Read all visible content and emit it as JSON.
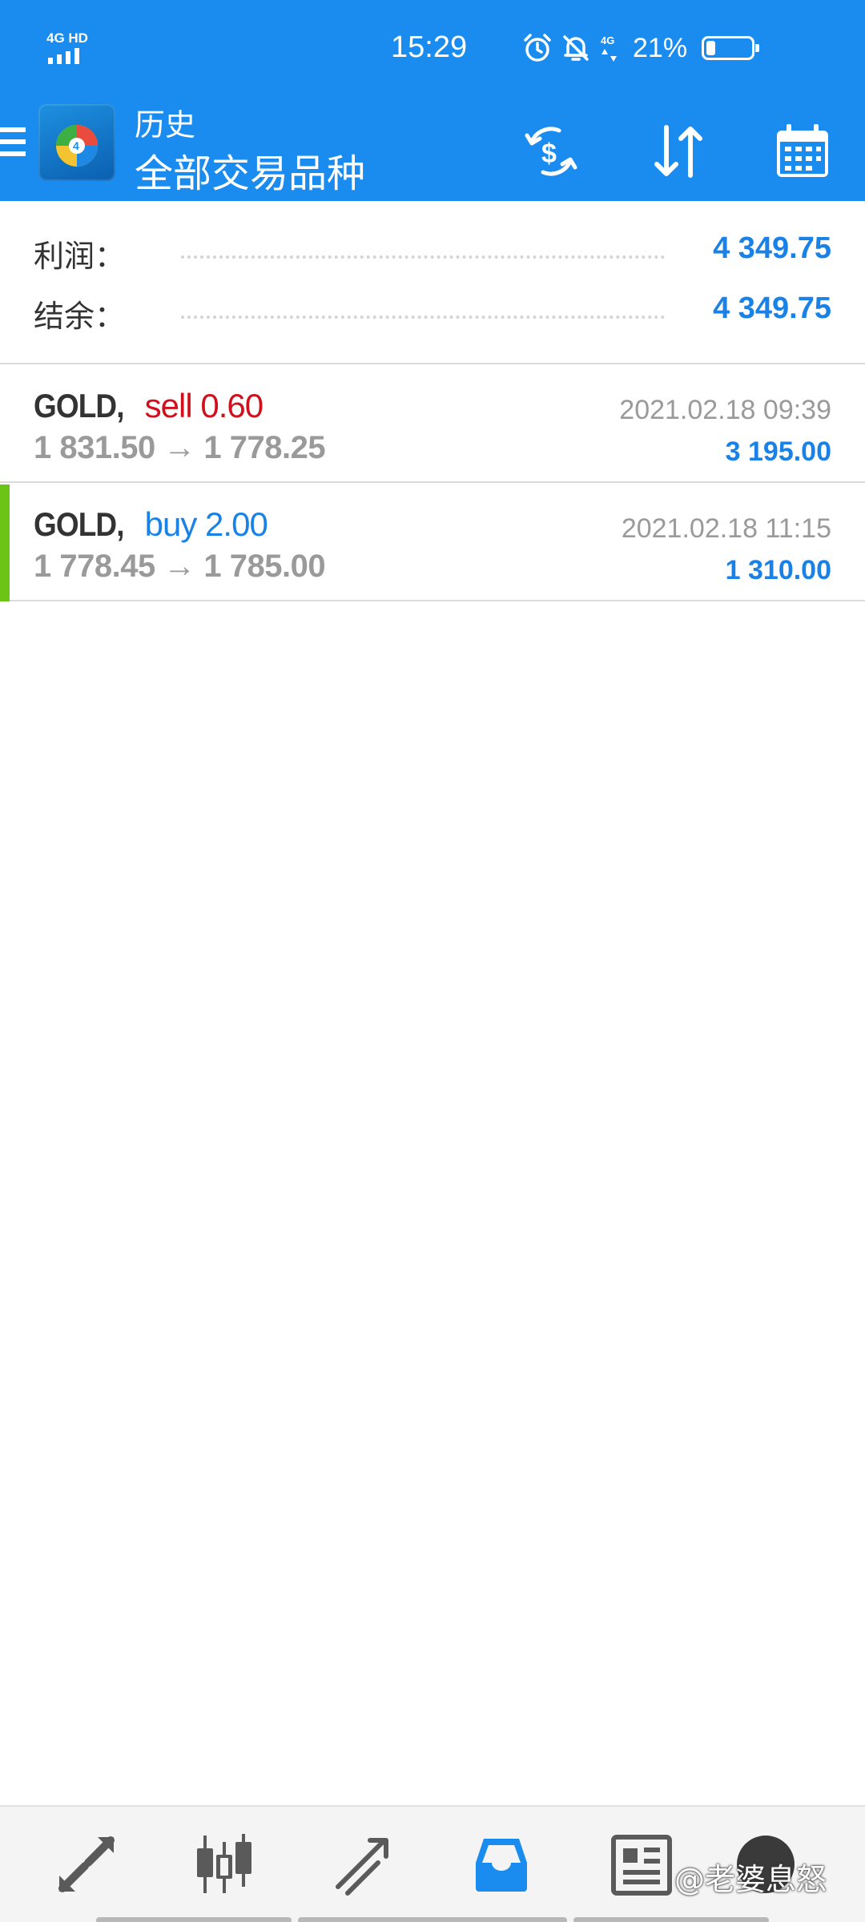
{
  "status_bar": {
    "network": "4G HD",
    "time": "15:29",
    "battery_percent": "21%",
    "battery_level": 0.21,
    "icons": [
      "alarm-icon",
      "mute-bell-icon",
      "4g-data-icon",
      "battery-icon"
    ]
  },
  "app_bar": {
    "subtitle": "历史",
    "title": "全部交易品种",
    "actions": [
      "currency-exchange-icon",
      "sort-icon",
      "calendar-icon"
    ]
  },
  "summary": {
    "profit_label": "利润：",
    "profit_value": "4 349.75",
    "balance_label": "结余：",
    "balance_value": "4 349.75"
  },
  "deals": [
    {
      "symbol": "GOLD,",
      "side": "sell 0.60",
      "prices": "1 831.50 → 1 778.25",
      "time": "2021.02.18 09:39",
      "profit": "3 195.00"
    },
    {
      "symbol": "GOLD,",
      "side": "buy 2.00",
      "prices": "1 778.45 → 1 785.00",
      "time": "2021.02.18 11:15",
      "profit": "1 310.00"
    }
  ],
  "bottom_nav": {
    "items": [
      "quotes-icon",
      "chart-icon",
      "trade-icon",
      "history-icon",
      "news-icon",
      "chat-icon"
    ],
    "active": "history-icon"
  },
  "watermark": "@老婆息怒",
  "colors": {
    "accent": "#1a8cf0",
    "profit_blue": "#1a82e6",
    "sell_red": "#d0101c",
    "buy_marker_green": "#6cc417",
    "muted_gray": "#9a9a9a"
  }
}
